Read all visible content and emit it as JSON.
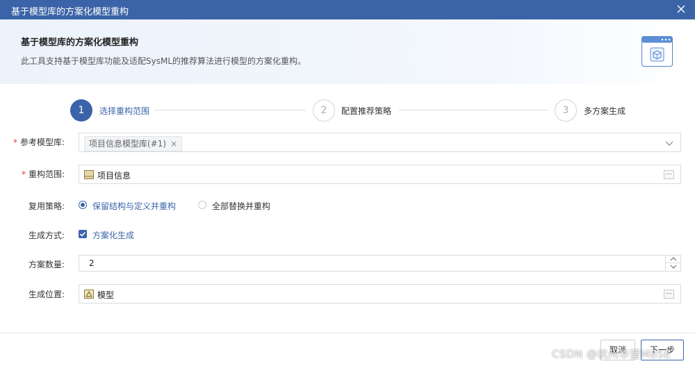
{
  "window": {
    "title": "基于模型库的方案化模型重构"
  },
  "header": {
    "title": "基于模型库的方案化模型重构",
    "description": "此工具支持基于模型库功能及适配SysML的推荐算法进行模型的方案化重构。"
  },
  "steps": [
    {
      "number": "1",
      "label": "选择重构范围",
      "active": true
    },
    {
      "number": "2",
      "label": "配置推荐策略",
      "active": false
    },
    {
      "number": "3",
      "label": "多方案生成",
      "active": false
    }
  ],
  "form": {
    "reference_library": {
      "label": "参考模型库:",
      "required": true,
      "tag": "项目信息模型库(#1)",
      "tag_remove": "×"
    },
    "scope": {
      "label": "重构范围:",
      "required": true,
      "value": "项目信息",
      "browse": "..."
    },
    "reuse_strategy": {
      "label": "复用策略:",
      "options": [
        {
          "label": "保留结构与定义并重构",
          "selected": true
        },
        {
          "label": "全部替换并重构",
          "selected": false
        }
      ]
    },
    "generation_mode": {
      "label": "生成方式:",
      "option": "方案化生成",
      "checked": true
    },
    "count": {
      "label": "方案数量:",
      "value": "2"
    },
    "location": {
      "label": "生成位置:",
      "value": "模型",
      "browse": "..."
    }
  },
  "footer": {
    "cancel": "取消",
    "next": "下一步"
  },
  "watermark": "CSDN @杭州华望MBSE",
  "colors": {
    "accent": "#3b64a8",
    "required": "#e53935",
    "title_bar": "#3b64a8"
  }
}
